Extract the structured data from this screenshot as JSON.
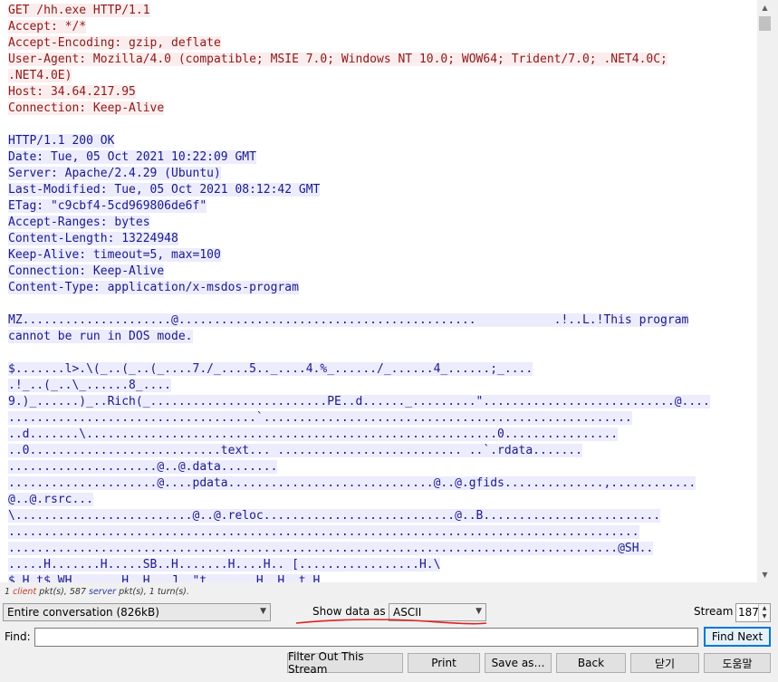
{
  "stream": {
    "lines": [
      {
        "type": "client",
        "text": "GET /hh.exe HTTP/1.1"
      },
      {
        "type": "client",
        "text": "Accept: */*"
      },
      {
        "type": "client",
        "text": "Accept-Encoding: gzip, deflate"
      },
      {
        "type": "client",
        "text": "User-Agent: Mozilla/4.0 (compatible; MSIE 7.0; Windows NT 10.0; WOW64; Trident/7.0; .NET4.0C;"
      },
      {
        "type": "client",
        "text": ".NET4.0E)"
      },
      {
        "type": "client",
        "text": "Host: 34.64.217.95"
      },
      {
        "type": "client",
        "text": "Connection: Keep-Alive"
      },
      {
        "type": "blank",
        "text": ""
      },
      {
        "type": "server",
        "text": "HTTP/1.1 200 OK"
      },
      {
        "type": "server",
        "text": "Date: Tue, 05 Oct 2021 10:22:09 GMT"
      },
      {
        "type": "server",
        "text": "Server: Apache/2.4.29 (Ubuntu)"
      },
      {
        "type": "server",
        "text": "Last-Modified: Tue, 05 Oct 2021 08:12:42 GMT"
      },
      {
        "type": "server",
        "text": "ETag: \"c9cbf4-5cd969806de6f\""
      },
      {
        "type": "server",
        "text": "Accept-Ranges: bytes"
      },
      {
        "type": "server",
        "text": "Content-Length: 13224948"
      },
      {
        "type": "server",
        "text": "Keep-Alive: timeout=5, max=100"
      },
      {
        "type": "server",
        "text": "Connection: Keep-Alive"
      },
      {
        "type": "server",
        "text": "Content-Type: application/x-msdos-program"
      },
      {
        "type": "blank",
        "text": ""
      },
      {
        "type": "server",
        "text": "MZ.....................@..........................................           .!..L.!This program"
      },
      {
        "type": "server",
        "text": "cannot be run in DOS mode."
      },
      {
        "type": "blank",
        "text": ""
      },
      {
        "type": "server",
        "text": "$.......l>.\\(_..(_..(_....7./_....5.._....4.%_....../_......4_......;_...."
      },
      {
        "type": "server",
        "text": ".!_..(_..\\_......8_...."
      },
      {
        "type": "server",
        "text": "9.)_......)_..Rich(_.........................PE..d......_.........\"...........................@...."
      },
      {
        "type": "server",
        "text": "...................................`...................................................."
      },
      {
        "type": "server",
        "text": "..d.......\\..........................................................0................"
      },
      {
        "type": "server",
        "text": "..0...........................text... .......................... ..`.rdata......."
      },
      {
        "type": "server",
        "text": ".....................@..@.data........"
      },
      {
        "type": "server",
        "text": ".....................@....pdata.............................@..@.gfids..............,............"
      },
      {
        "type": "server",
        "text": "@..@.rsrc..."
      },
      {
        "type": "server",
        "text": "\\.........................@..@.reloc...........................@..B........................."
      },
      {
        "type": "server",
        "text": "........................................................................................."
      },
      {
        "type": "server",
        "text": "......................................................................................@SH.."
      },
      {
        "type": "server",
        "text": ".....H.......H.....SB..H.......H....H.. [.................H.\\"
      },
      {
        "type": "server",
        "text": "$.H.t$.WH.......H..H...J..\"t.......H..H..t.H"
      }
    ]
  },
  "stats": {
    "client_count": "1",
    "client_word": "client",
    "mid": " pkt(s), 587 ",
    "server_word": "server",
    "tail": " pkt(s), 1 turn(s)."
  },
  "controls": {
    "conversation_select": "Entire conversation (826kB)",
    "show_data_label": "Show data as",
    "format_select": "ASCII",
    "stream_label": "Stream",
    "stream_value": "187",
    "find_label": "Find:",
    "find_value": "",
    "find_next": "Find Next"
  },
  "buttons": {
    "filter_out": "Filter Out This Stream",
    "print": "Print",
    "save_as": "Save as…",
    "back": "Back",
    "close": "닫기",
    "help": "도움말"
  },
  "colors": {
    "client_text": "#8b1a1a",
    "client_bg": "#fbeded",
    "server_text": "#1a1a8c",
    "server_bg": "#ececfc",
    "annotation": "#e02020"
  }
}
